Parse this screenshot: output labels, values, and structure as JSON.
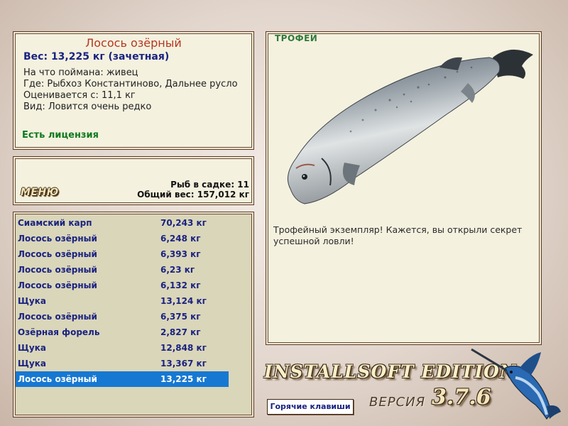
{
  "fish": {
    "name": "Лосось озёрный",
    "weight_line": "Вес: 13,225 кг (зачетная)",
    "details": [
      "На что поймана: живец",
      "Где: Рыбхоз Константиново, Дальнее русло",
      "Оценивается с: 11,1 кг",
      "Вид: Ловится очень редко"
    ],
    "license": "Есть лицензия"
  },
  "menu": {
    "label": "МЕНЮ"
  },
  "stats": {
    "count": "Рыб в садке: 11",
    "total_weight": "Общий вес: 157,012 кг"
  },
  "catch": [
    {
      "name": "Сиамский карп",
      "weight": "70,243 кг"
    },
    {
      "name": "Лосось озёрный",
      "weight": "6,248 кг"
    },
    {
      "name": "Лосось озёрный",
      "weight": "6,393 кг"
    },
    {
      "name": "Лосось озёрный",
      "weight": "6,23 кг"
    },
    {
      "name": "Лосось озёрный",
      "weight": "6,132 кг"
    },
    {
      "name": "Щука",
      "weight": "13,124 кг"
    },
    {
      "name": "Лосось озёрный",
      "weight": "6,375 кг"
    },
    {
      "name": "Озёрная форель",
      "weight": "2,827 кг"
    },
    {
      "name": "Щука",
      "weight": "12,848 кг"
    },
    {
      "name": "Щука",
      "weight": "13,367 кг"
    },
    {
      "name": "Лосось озёрный",
      "weight": "13,225 кг",
      "selected": true
    }
  ],
  "trophy": {
    "label": "ТРОФЕЙ",
    "text": "Трофейный экземпляр! Кажется, вы открыли секрет успешной ловли!"
  },
  "brand": {
    "edition": "INSTALLSOFT EDITION",
    "version_label": "ВЕРСИЯ",
    "version_number": "3.7.6"
  },
  "hotkeys": {
    "label": "Горячие клавиши"
  },
  "colors": {
    "title": "#b5371f",
    "weight": "#1a2380",
    "license": "#0f7a1e",
    "selection": "#1778d2",
    "trophy_label": "#2f7a3a"
  },
  "icons": [
    "salmon-image",
    "marlin-logo"
  ]
}
